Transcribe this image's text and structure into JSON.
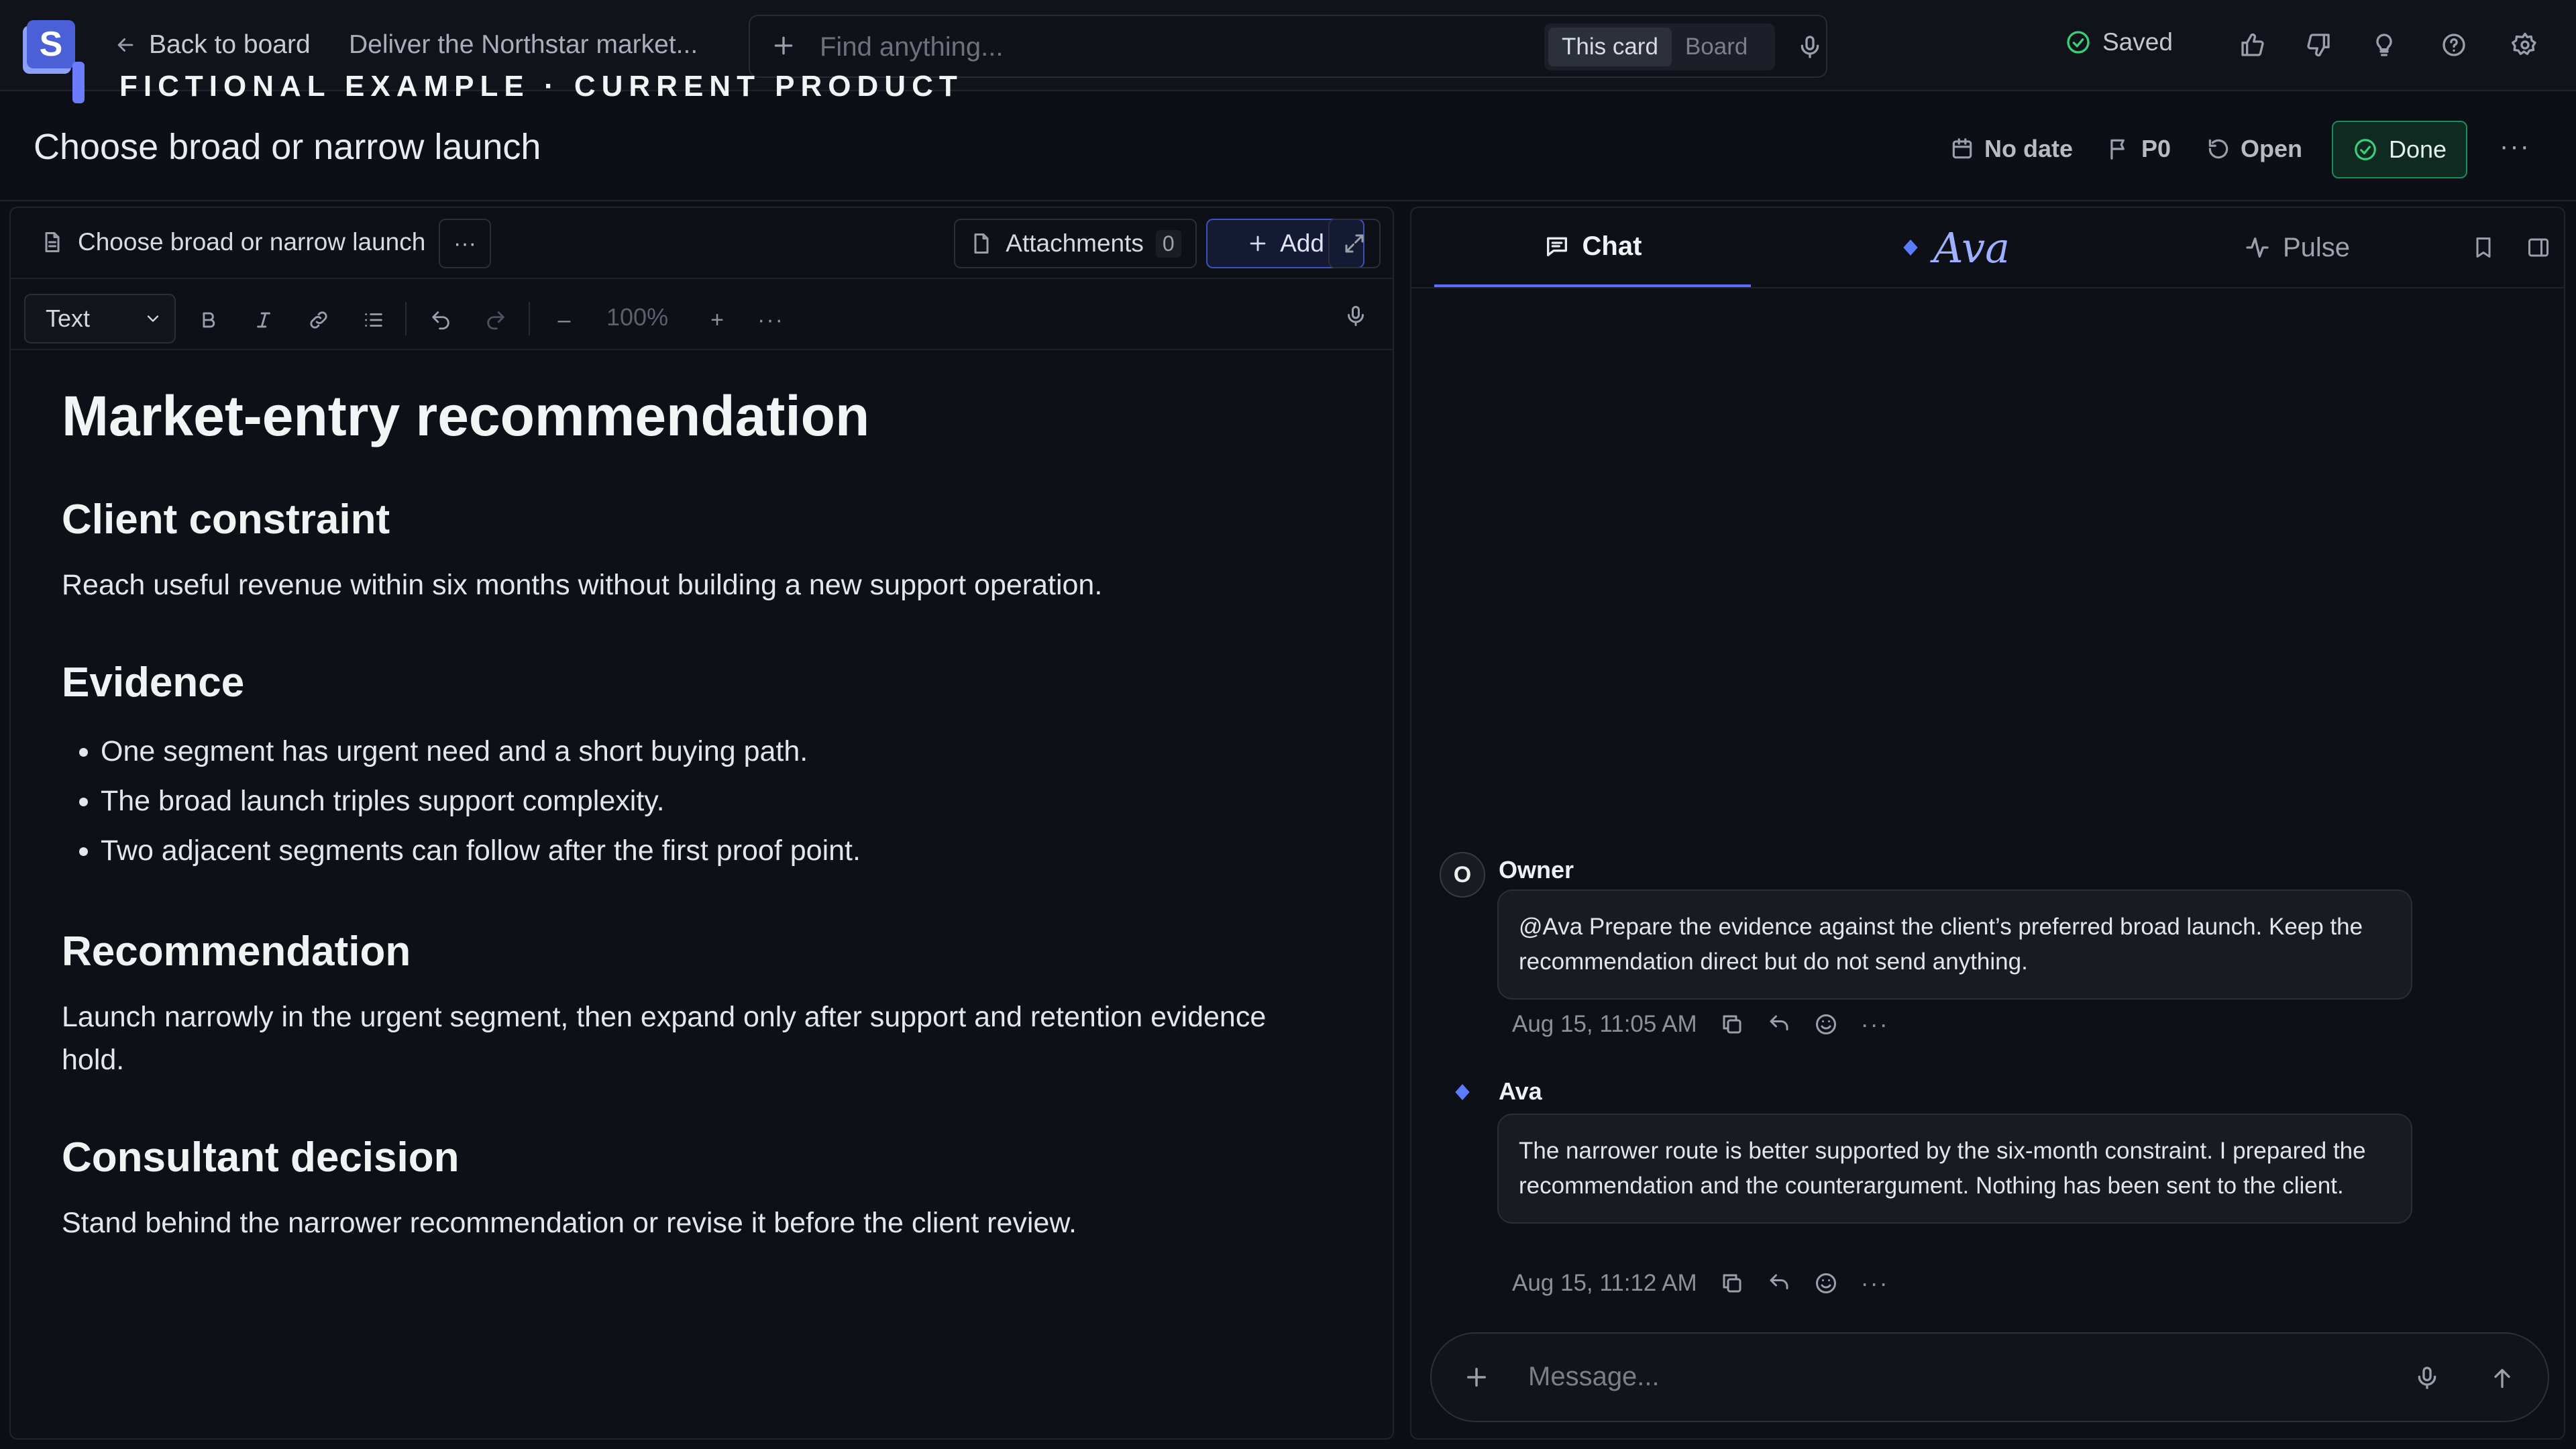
{
  "header": {
    "logo_letter": "S",
    "back_label": "Back to board",
    "breadcrumb": "Deliver the Northstar market...",
    "watermark": "FICTIONAL EXAMPLE · CURRENT PRODUCT",
    "search": {
      "placeholder": "Find anything...",
      "scope_options": [
        "This card",
        "Board"
      ],
      "scope_selected": "This card"
    },
    "save_status": "Saved",
    "icons": [
      "thumbs-up-icon",
      "thumbs-down-icon",
      "lightbulb-icon",
      "help-icon",
      "settings-icon"
    ]
  },
  "card": {
    "title": "Choose broad or narrow launch",
    "date": "No date",
    "priority": "P0",
    "status": "Open",
    "done_label": "Done",
    "more": "···"
  },
  "editor": {
    "doc_name": "Choose broad or narrow launch",
    "more": "···",
    "attachments_label": "Attachments",
    "attachments_count": "0",
    "add_label": "Add",
    "block_type": "Text",
    "zoom": "100%",
    "zoom_minus": "–",
    "zoom_plus": "+",
    "tool_more": "···"
  },
  "document": {
    "heading": "Market-entry recommendation",
    "sections": [
      {
        "title": "Client constraint",
        "body": "Reach useful revenue within six months without building a new support operation."
      },
      {
        "title": "Evidence",
        "bullets": [
          "One segment has urgent need and a short buying path.",
          "The broad launch triples support complexity.",
          "Two adjacent segments can follow after the first proof point."
        ]
      },
      {
        "title": "Recommendation",
        "body": "Launch narrowly in the urgent segment, then expand only after support and retention evidence hold."
      },
      {
        "title": "Consultant decision",
        "body": "Stand behind the narrower recommendation or revise it before the client review."
      }
    ]
  },
  "chat": {
    "tabs": [
      {
        "label": "Chat",
        "active": true
      },
      {
        "label": "Ava",
        "active": false
      },
      {
        "label": "Pulse",
        "active": false
      }
    ],
    "messages": [
      {
        "avatar": "O",
        "sender": "Owner",
        "text": "@Ava Prepare the evidence against the client’s preferred broad launch. Keep the recommendation direct but do not send anything.",
        "time": "Aug 15, 11:05 AM"
      },
      {
        "sender": "Ava",
        "text": "The narrower route is better supported by the six-month constraint. I prepared the recommendation and the counterargument. Nothing has been sent to the client.",
        "time": "Aug 15, 11:12 AM"
      }
    ],
    "composer_placeholder": "Message..."
  },
  "colors": {
    "background": "#0c0f16",
    "accent": "#5b6cff",
    "done_border": "#1f8a5a",
    "saved_check": "#3ccf7a"
  }
}
